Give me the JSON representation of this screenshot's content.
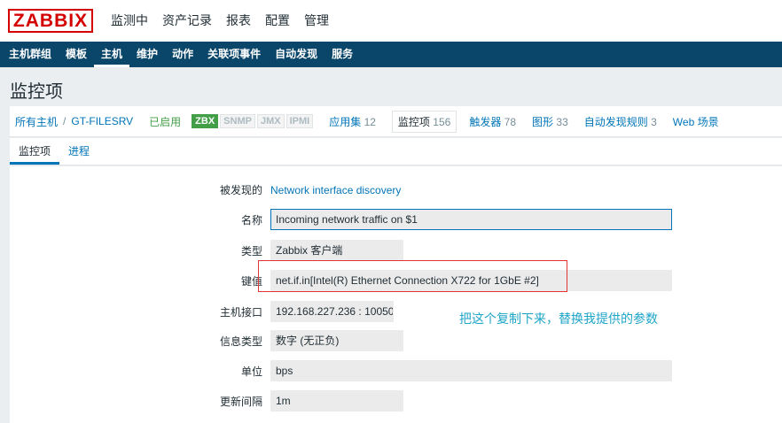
{
  "logo": "ZABBIX",
  "topmenu": [
    "监测中",
    "资产记录",
    "报表",
    "配置",
    "管理"
  ],
  "subnav": [
    "主机群组",
    "模板",
    "主机",
    "维护",
    "动作",
    "关联项事件",
    "自动发现",
    "服务"
  ],
  "page_title": "监控项",
  "breadcrumb": {
    "all_hosts": "所有主机",
    "separator": "/",
    "host": "GT-FILESRV",
    "status": "已启用",
    "tags": [
      "ZBX",
      "SNMP",
      "JMX",
      "IPMI"
    ],
    "links": [
      {
        "label": "应用集",
        "count": "12"
      },
      {
        "label": "监控项",
        "count": "156"
      },
      {
        "label": "触发器",
        "count": "78"
      },
      {
        "label": "图形",
        "count": "33"
      },
      {
        "label": "自动发现规则",
        "count": "3"
      },
      {
        "label": "Web 场景",
        "count": ""
      }
    ]
  },
  "form_tabs": [
    "监控项",
    "进程"
  ],
  "form": {
    "discovered_label": "被发现的",
    "discovered_value": "Network interface discovery",
    "name_label": "名称",
    "name_value": "Incoming network traffic on $1",
    "type_label": "类型",
    "type_value": "Zabbix 客户端",
    "key_label": "键值",
    "key_value": "net.if.in[Intel(R) Ethernet Connection X722 for 1GbE #2]",
    "interface_label": "主机接口",
    "interface_value": "192.168.227.236 : 10050",
    "info_type_label": "信息类型",
    "info_type_value": "数字 (无正负)",
    "unit_label": "单位",
    "unit_value": "bps",
    "interval_label": "更新间隔",
    "interval_value": "1m"
  },
  "annotation": "把这个复制下来，替换我提供的参数",
  "colors": {
    "accent": "#0275b8",
    "nav": "#0a466a",
    "logo": "#d40000",
    "enabled": "#429e47",
    "annotation": "#1ea5c8",
    "highlight": "#e33434"
  }
}
